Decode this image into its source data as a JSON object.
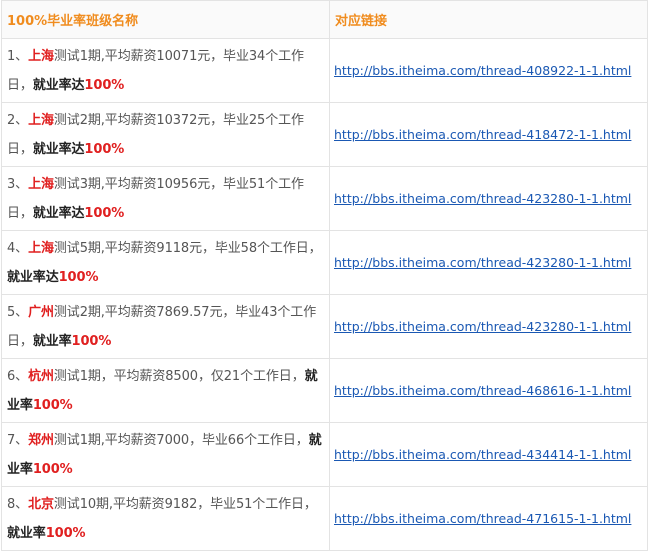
{
  "header": {
    "col1": "100%毕业率班级名称",
    "col2": "对应链接"
  },
  "rows": [
    {
      "prefix": "1、",
      "city": "上海",
      "middle": "测试1期,平均薪资10071元，毕业34个工作日，",
      "rate_label": "就业率达",
      "rate": "100%",
      "link": "http://bbs.itheima.com/thread-408922-1-1.html"
    },
    {
      "prefix": "2、",
      "city": "上海",
      "middle": "测试2期,平均薪资10372元，毕业25个工作日，",
      "rate_label": "就业率达",
      "rate": "100%",
      "link": "http://bbs.itheima.com/thread-418472-1-1.html"
    },
    {
      "prefix": "3、",
      "city": "上海",
      "middle": "测试3期,平均薪资10956元，毕业51个工作日，",
      "rate_label": "就业率达",
      "rate": "100%",
      "link": "http://bbs.itheima.com/thread-423280-1-1.html"
    },
    {
      "prefix": "4、",
      "city": "上海",
      "middle": "测试5期,平均薪资9118元，毕业58个工作日，",
      "rate_label": "就业率达",
      "rate": "100%",
      "link": "http://bbs.itheima.com/thread-423280-1-1.html"
    },
    {
      "prefix": "5、",
      "city": "广州",
      "middle": "测试2期,平均薪资7869.57元，毕业43个工作日，",
      "rate_label": "就业率",
      "rate": "100%",
      "link": "http://bbs.itheima.com/thread-423280-1-1.html"
    },
    {
      "prefix": "6、",
      "city": "杭州",
      "middle": "测试1期，平均薪资8500，仅21个工作日，",
      "rate_label": "就业率",
      "rate": "100%",
      "link": "http://bbs.itheima.com/thread-468616-1-1.html"
    },
    {
      "prefix": "7、",
      "city": "郑州",
      "middle": "测试1期,平均薪资7000，毕业66个工作日，",
      "rate_label": "就业率",
      "rate": "100%",
      "link": "http://bbs.itheima.com/thread-434414-1-1.html"
    },
    {
      "prefix": "8、",
      "city": "北京",
      "middle": "测试10期,平均薪资9182，毕业51个工作日，",
      "rate_label": "就业率",
      "rate": "100%",
      "link": "http://bbs.itheima.com/thread-471615-1-1.html"
    }
  ]
}
